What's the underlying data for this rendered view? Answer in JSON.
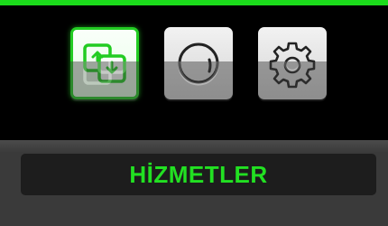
{
  "colors": {
    "accent": "#1bdc1b",
    "label_text": "#22e022",
    "panel": "#3a3a3a",
    "label_bg": "#1d1d1d"
  },
  "menu": {
    "items": [
      {
        "icon": "swap-squares-icon",
        "selected": true
      },
      {
        "icon": "dial-icon",
        "selected": false
      },
      {
        "icon": "gear-icon",
        "selected": false
      }
    ]
  },
  "selected_label": "HİZMETLER"
}
